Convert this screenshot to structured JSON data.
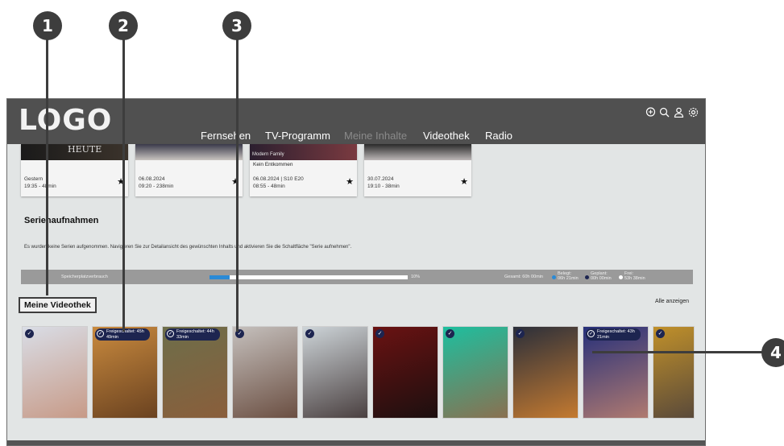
{
  "callouts": [
    "1",
    "2",
    "3",
    "4"
  ],
  "header": {
    "logo": "LOGO",
    "nav": [
      "Fernsehen",
      "TV-Programm",
      "Meine Inhalte",
      "Videothek",
      "Radio"
    ],
    "icons": [
      "chat-plus-icon",
      "search-icon",
      "user-icon",
      "settings-icon"
    ]
  },
  "recordings": [
    {
      "title": "",
      "line1": "Gestern",
      "line2": "19:35 - 48min",
      "thumb_text": "HEUTE",
      "colors": [
        "#1f1f1f",
        "#5a4a3a"
      ]
    },
    {
      "title": "",
      "line1": "06.08.2024",
      "line2": "09:20 - 238min",
      "thumb_text": "",
      "colors": [
        "#3a3a4a",
        "#c9c4c0"
      ]
    },
    {
      "title": "Kein Entkommen",
      "line1": "06.08.2024 | S10 E20",
      "line2": "08:55 - 48min",
      "thumb_text": "Modern Family",
      "colors": [
        "#2b1f2f",
        "#7a3a40"
      ]
    },
    {
      "title": "",
      "line1": "30.07.2024",
      "line2": "19:10 - 38min",
      "thumb_text": "",
      "colors": [
        "#2a2a2a",
        "#bdb8b8"
      ]
    }
  ],
  "series": {
    "title": "Serienaufnahmen",
    "info": "Es wurden keine Serien aufgenommen. Navigieren Sie zur Detailansicht des gewünschten Inhalts und aktivieren Sie die Schaltfläche \"Serie aufnehmen\"."
  },
  "storage": {
    "label": "Speicherplatzverbrauch",
    "percent_label": "10%",
    "fill_fraction": 0.1,
    "total": "Gesamt: 60h 00min",
    "used_label": "Belegt:",
    "used_value": "06h 21min",
    "planned_label": "Geplant:",
    "planned_value": "00h 00min",
    "free_label": "Frei:",
    "free_value": "53h 38min",
    "colors": {
      "used": "#2a8ad6",
      "planned": "#1d2550",
      "free": "#ffffff"
    }
  },
  "videothek": {
    "title": "Meine Videothek",
    "show_all": "Alle anzeigen",
    "posters": [
      {
        "badge": "",
        "colors": [
          "#d9dde6",
          "#c79a87"
        ]
      },
      {
        "badge": "Freigeschaltet: 45h 49min",
        "colors": [
          "#c98a3e",
          "#6a4220"
        ]
      },
      {
        "badge": "Freigeschaltet: 44h 33min",
        "colors": [
          "#6d6e4a",
          "#8a5e3b"
        ]
      },
      {
        "badge": "",
        "colors": [
          "#c5c0bd",
          "#6b4f42"
        ]
      },
      {
        "badge": "",
        "colors": [
          "#cdd4d8",
          "#4a4040"
        ]
      },
      {
        "badge": "",
        "colors": [
          "#6a1212",
          "#1c0f0f"
        ]
      },
      {
        "badge": "",
        "colors": [
          "#1dbf9f",
          "#8a7050"
        ]
      },
      {
        "badge": "",
        "colors": [
          "#2b2f3a",
          "#c47a30"
        ]
      },
      {
        "badge": "Freigeschaltet: 43h 21min",
        "colors": [
          "#26307a",
          "#b07a70"
        ]
      },
      {
        "badge": "",
        "colors": [
          "#c0902a",
          "#5a4a3a"
        ]
      }
    ]
  }
}
